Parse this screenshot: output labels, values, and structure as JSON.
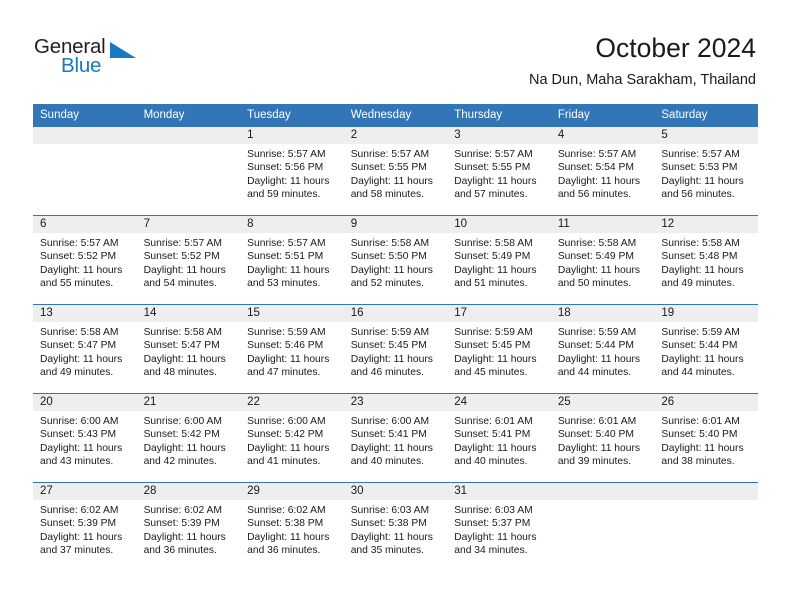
{
  "brand": {
    "name_top": "General",
    "name_bottom": "Blue"
  },
  "header": {
    "title": "October 2024",
    "subtitle": "Na Dun, Maha Sarakham, Thailand"
  },
  "colors": {
    "header_blue": "#3276b8",
    "brand_blue": "#1878c4",
    "daynum_band": "#eeeeee"
  },
  "weekdays": [
    "Sunday",
    "Monday",
    "Tuesday",
    "Wednesday",
    "Thursday",
    "Friday",
    "Saturday"
  ],
  "weeks": [
    [
      {
        "day": "",
        "sunrise": "",
        "sunset": "",
        "daylight1": "",
        "daylight2": ""
      },
      {
        "day": "",
        "sunrise": "",
        "sunset": "",
        "daylight1": "",
        "daylight2": ""
      },
      {
        "day": "1",
        "sunrise": "Sunrise: 5:57 AM",
        "sunset": "Sunset: 5:56 PM",
        "daylight1": "Daylight: 11 hours",
        "daylight2": "and 59 minutes."
      },
      {
        "day": "2",
        "sunrise": "Sunrise: 5:57 AM",
        "sunset": "Sunset: 5:55 PM",
        "daylight1": "Daylight: 11 hours",
        "daylight2": "and 58 minutes."
      },
      {
        "day": "3",
        "sunrise": "Sunrise: 5:57 AM",
        "sunset": "Sunset: 5:55 PM",
        "daylight1": "Daylight: 11 hours",
        "daylight2": "and 57 minutes."
      },
      {
        "day": "4",
        "sunrise": "Sunrise: 5:57 AM",
        "sunset": "Sunset: 5:54 PM",
        "daylight1": "Daylight: 11 hours",
        "daylight2": "and 56 minutes."
      },
      {
        "day": "5",
        "sunrise": "Sunrise: 5:57 AM",
        "sunset": "Sunset: 5:53 PM",
        "daylight1": "Daylight: 11 hours",
        "daylight2": "and 56 minutes."
      }
    ],
    [
      {
        "day": "6",
        "sunrise": "Sunrise: 5:57 AM",
        "sunset": "Sunset: 5:52 PM",
        "daylight1": "Daylight: 11 hours",
        "daylight2": "and 55 minutes."
      },
      {
        "day": "7",
        "sunrise": "Sunrise: 5:57 AM",
        "sunset": "Sunset: 5:52 PM",
        "daylight1": "Daylight: 11 hours",
        "daylight2": "and 54 minutes."
      },
      {
        "day": "8",
        "sunrise": "Sunrise: 5:57 AM",
        "sunset": "Sunset: 5:51 PM",
        "daylight1": "Daylight: 11 hours",
        "daylight2": "and 53 minutes."
      },
      {
        "day": "9",
        "sunrise": "Sunrise: 5:58 AM",
        "sunset": "Sunset: 5:50 PM",
        "daylight1": "Daylight: 11 hours",
        "daylight2": "and 52 minutes."
      },
      {
        "day": "10",
        "sunrise": "Sunrise: 5:58 AM",
        "sunset": "Sunset: 5:49 PM",
        "daylight1": "Daylight: 11 hours",
        "daylight2": "and 51 minutes."
      },
      {
        "day": "11",
        "sunrise": "Sunrise: 5:58 AM",
        "sunset": "Sunset: 5:49 PM",
        "daylight1": "Daylight: 11 hours",
        "daylight2": "and 50 minutes."
      },
      {
        "day": "12",
        "sunrise": "Sunrise: 5:58 AM",
        "sunset": "Sunset: 5:48 PM",
        "daylight1": "Daylight: 11 hours",
        "daylight2": "and 49 minutes."
      }
    ],
    [
      {
        "day": "13",
        "sunrise": "Sunrise: 5:58 AM",
        "sunset": "Sunset: 5:47 PM",
        "daylight1": "Daylight: 11 hours",
        "daylight2": "and 49 minutes."
      },
      {
        "day": "14",
        "sunrise": "Sunrise: 5:58 AM",
        "sunset": "Sunset: 5:47 PM",
        "daylight1": "Daylight: 11 hours",
        "daylight2": "and 48 minutes."
      },
      {
        "day": "15",
        "sunrise": "Sunrise: 5:59 AM",
        "sunset": "Sunset: 5:46 PM",
        "daylight1": "Daylight: 11 hours",
        "daylight2": "and 47 minutes."
      },
      {
        "day": "16",
        "sunrise": "Sunrise: 5:59 AM",
        "sunset": "Sunset: 5:45 PM",
        "daylight1": "Daylight: 11 hours",
        "daylight2": "and 46 minutes."
      },
      {
        "day": "17",
        "sunrise": "Sunrise: 5:59 AM",
        "sunset": "Sunset: 5:45 PM",
        "daylight1": "Daylight: 11 hours",
        "daylight2": "and 45 minutes."
      },
      {
        "day": "18",
        "sunrise": "Sunrise: 5:59 AM",
        "sunset": "Sunset: 5:44 PM",
        "daylight1": "Daylight: 11 hours",
        "daylight2": "and 44 minutes."
      },
      {
        "day": "19",
        "sunrise": "Sunrise: 5:59 AM",
        "sunset": "Sunset: 5:44 PM",
        "daylight1": "Daylight: 11 hours",
        "daylight2": "and 44 minutes."
      }
    ],
    [
      {
        "day": "20",
        "sunrise": "Sunrise: 6:00 AM",
        "sunset": "Sunset: 5:43 PM",
        "daylight1": "Daylight: 11 hours",
        "daylight2": "and 43 minutes."
      },
      {
        "day": "21",
        "sunrise": "Sunrise: 6:00 AM",
        "sunset": "Sunset: 5:42 PM",
        "daylight1": "Daylight: 11 hours",
        "daylight2": "and 42 minutes."
      },
      {
        "day": "22",
        "sunrise": "Sunrise: 6:00 AM",
        "sunset": "Sunset: 5:42 PM",
        "daylight1": "Daylight: 11 hours",
        "daylight2": "and 41 minutes."
      },
      {
        "day": "23",
        "sunrise": "Sunrise: 6:00 AM",
        "sunset": "Sunset: 5:41 PM",
        "daylight1": "Daylight: 11 hours",
        "daylight2": "and 40 minutes."
      },
      {
        "day": "24",
        "sunrise": "Sunrise: 6:01 AM",
        "sunset": "Sunset: 5:41 PM",
        "daylight1": "Daylight: 11 hours",
        "daylight2": "and 40 minutes."
      },
      {
        "day": "25",
        "sunrise": "Sunrise: 6:01 AM",
        "sunset": "Sunset: 5:40 PM",
        "daylight1": "Daylight: 11 hours",
        "daylight2": "and 39 minutes."
      },
      {
        "day": "26",
        "sunrise": "Sunrise: 6:01 AM",
        "sunset": "Sunset: 5:40 PM",
        "daylight1": "Daylight: 11 hours",
        "daylight2": "and 38 minutes."
      }
    ],
    [
      {
        "day": "27",
        "sunrise": "Sunrise: 6:02 AM",
        "sunset": "Sunset: 5:39 PM",
        "daylight1": "Daylight: 11 hours",
        "daylight2": "and 37 minutes."
      },
      {
        "day": "28",
        "sunrise": "Sunrise: 6:02 AM",
        "sunset": "Sunset: 5:39 PM",
        "daylight1": "Daylight: 11 hours",
        "daylight2": "and 36 minutes."
      },
      {
        "day": "29",
        "sunrise": "Sunrise: 6:02 AM",
        "sunset": "Sunset: 5:38 PM",
        "daylight1": "Daylight: 11 hours",
        "daylight2": "and 36 minutes."
      },
      {
        "day": "30",
        "sunrise": "Sunrise: 6:03 AM",
        "sunset": "Sunset: 5:38 PM",
        "daylight1": "Daylight: 11 hours",
        "daylight2": "and 35 minutes."
      },
      {
        "day": "31",
        "sunrise": "Sunrise: 6:03 AM",
        "sunset": "Sunset: 5:37 PM",
        "daylight1": "Daylight: 11 hours",
        "daylight2": "and 34 minutes."
      },
      {
        "day": "",
        "sunrise": "",
        "sunset": "",
        "daylight1": "",
        "daylight2": ""
      },
      {
        "day": "",
        "sunrise": "",
        "sunset": "",
        "daylight1": "",
        "daylight2": ""
      }
    ]
  ]
}
